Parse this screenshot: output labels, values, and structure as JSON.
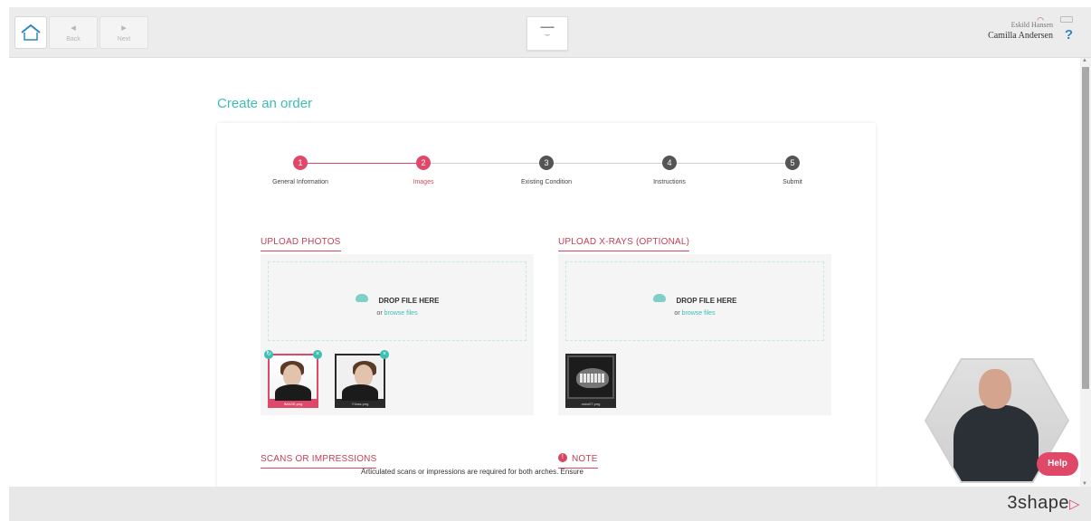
{
  "nav": {
    "back_label": "Back",
    "next_label": "Next"
  },
  "user": {
    "primary": "Eskild Hansen",
    "secondary": "Camilla Andersen",
    "help_glyph": "?"
  },
  "page": {
    "title": "Create an order"
  },
  "steps": [
    {
      "number": "1",
      "label": "General Information",
      "state": "done"
    },
    {
      "number": "2",
      "label": "Images",
      "state": "current"
    },
    {
      "number": "3",
      "label": "Existing Condition",
      "state": "pending"
    },
    {
      "number": "4",
      "label": "Instructions",
      "state": "pending"
    },
    {
      "number": "5",
      "label": "Submit",
      "state": "pending"
    }
  ],
  "upload_photos": {
    "heading": "UPLOAD PHOTOS",
    "drop_title": "DROP FILE HERE",
    "drop_or": "or",
    "browse": "browse files",
    "files": [
      "IMAGE.png",
      "Y1sss.png"
    ]
  },
  "upload_xrays": {
    "heading": "UPLOAD X-RAYS (OPTIONAL)",
    "drop_title": "DROP FILE HERE",
    "drop_or": "or",
    "browse": "browse files",
    "files": [
      "xsbo07.png"
    ]
  },
  "scans": {
    "heading": "SCANS OR IMPRESSIONS"
  },
  "note": {
    "heading": "NOTE",
    "icon": "!",
    "text": "Articulated scans or impressions are required for both arches. Ensure"
  },
  "help": {
    "label": "Help"
  },
  "brand": {
    "name": "3shape",
    "mark": "▷"
  },
  "colors": {
    "accent": "#e0486a",
    "teal": "#3bbfb3"
  }
}
